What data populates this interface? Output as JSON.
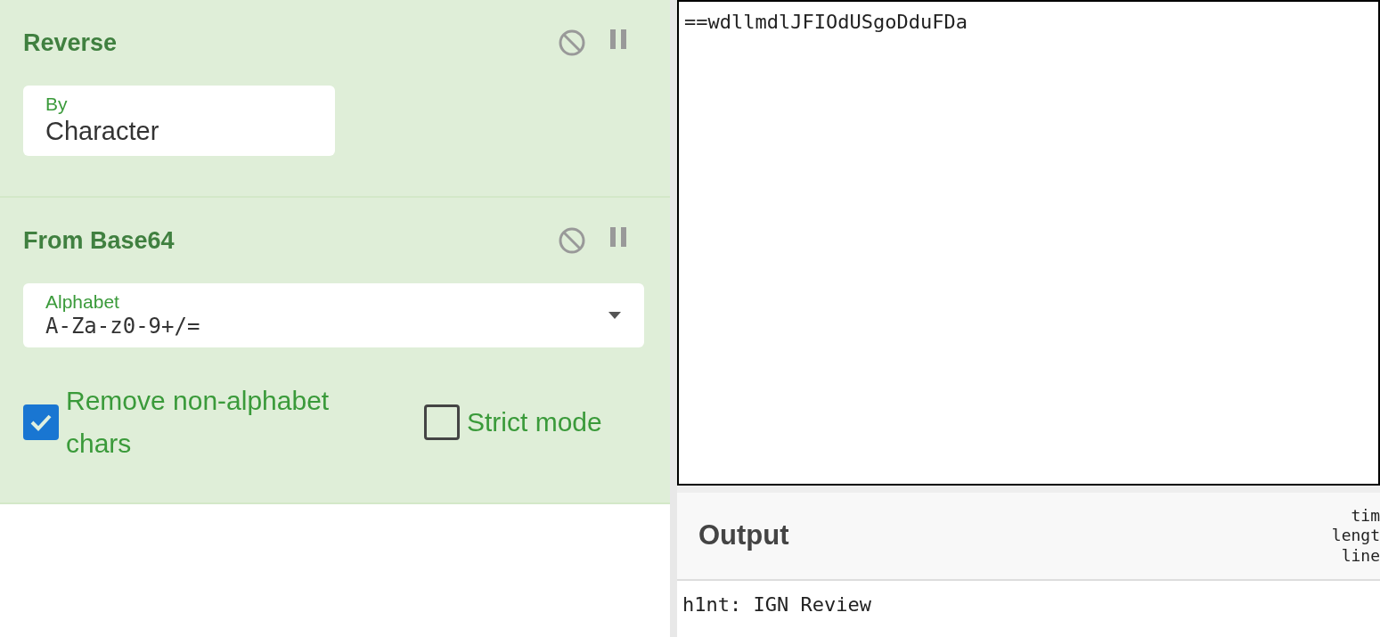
{
  "recipe": [
    {
      "title": "Reverse",
      "args": [
        {
          "kind": "text",
          "label": "By",
          "value": "Character"
        }
      ]
    },
    {
      "title": "From Base64",
      "args": [
        {
          "kind": "select",
          "label": "Alphabet",
          "value": "A-Za-z0-9+/="
        },
        {
          "kind": "checkboxes",
          "items": [
            {
              "label": "Remove non-alphabet chars",
              "checked": true
            },
            {
              "label": "Strict mode",
              "checked": false
            }
          ]
        }
      ]
    }
  ],
  "input": {
    "value": "==wdllmdlJFIOdUSgoDduFDa"
  },
  "output": {
    "title": "Output",
    "stats": [
      "tim",
      "lengt",
      "line"
    ],
    "value": "h1nt: IGN Review"
  }
}
